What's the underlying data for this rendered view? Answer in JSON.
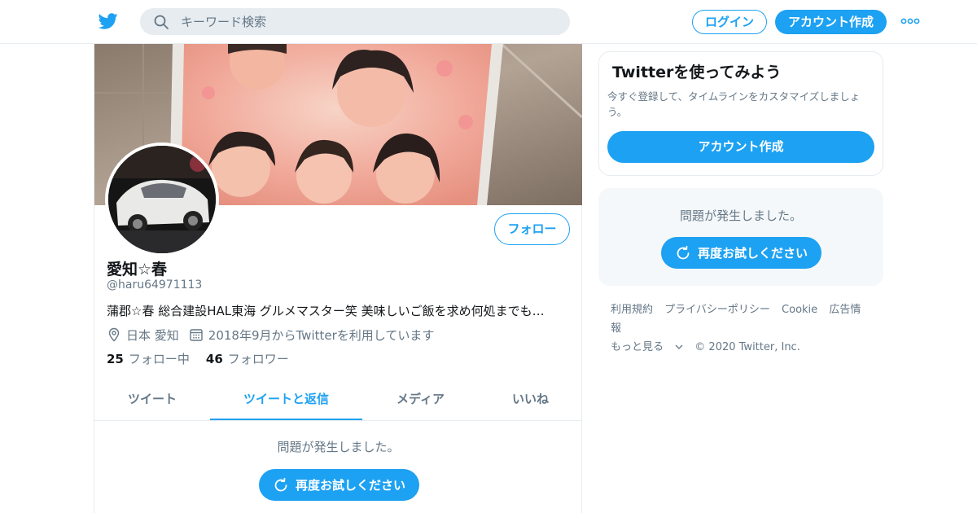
{
  "header": {
    "search_placeholder": "キーワード検索",
    "login_label": "ログイン",
    "signup_label": "アカウント作成"
  },
  "profile": {
    "name": "愛知☆春",
    "handle": "@haru64971113",
    "bio": "蒲郡☆春 総合建設HAL東海 グルメマスター笑 美味しいご飯を求め何処までも…",
    "location": "日本 愛知",
    "joined": "2018年9月からTwitterを利用しています",
    "following_count": "25",
    "following_label": "フォロー中",
    "followers_count": "46",
    "followers_label": "フォロワー",
    "follow_button": "フォロー"
  },
  "tabs": [
    {
      "label": "ツイート",
      "active": false
    },
    {
      "label": "ツイートと返信",
      "active": true
    },
    {
      "label": "メディア",
      "active": false
    },
    {
      "label": "いいね",
      "active": false
    }
  ],
  "timeline": {
    "error_text": "問題が発生しました。",
    "retry_label": "再度お試しください"
  },
  "sidebar": {
    "card_title": "Twitterを使ってみよう",
    "card_text": "今すぐ登録して、タイムラインをカスタマイズしましょう。",
    "card_button": "アカウント作成",
    "error_text": "問題が発生しました。",
    "retry_label": "再度お試しください"
  },
  "footer": {
    "links": [
      "利用規約",
      "プライバシーポリシー",
      "Cookie",
      "広告情報"
    ],
    "more": "もっと見る",
    "copyright": "© 2020 Twitter, Inc."
  },
  "colors": {
    "accent": "#1da1f2",
    "secondary_text": "#657786",
    "border": "#e6ecf0"
  }
}
